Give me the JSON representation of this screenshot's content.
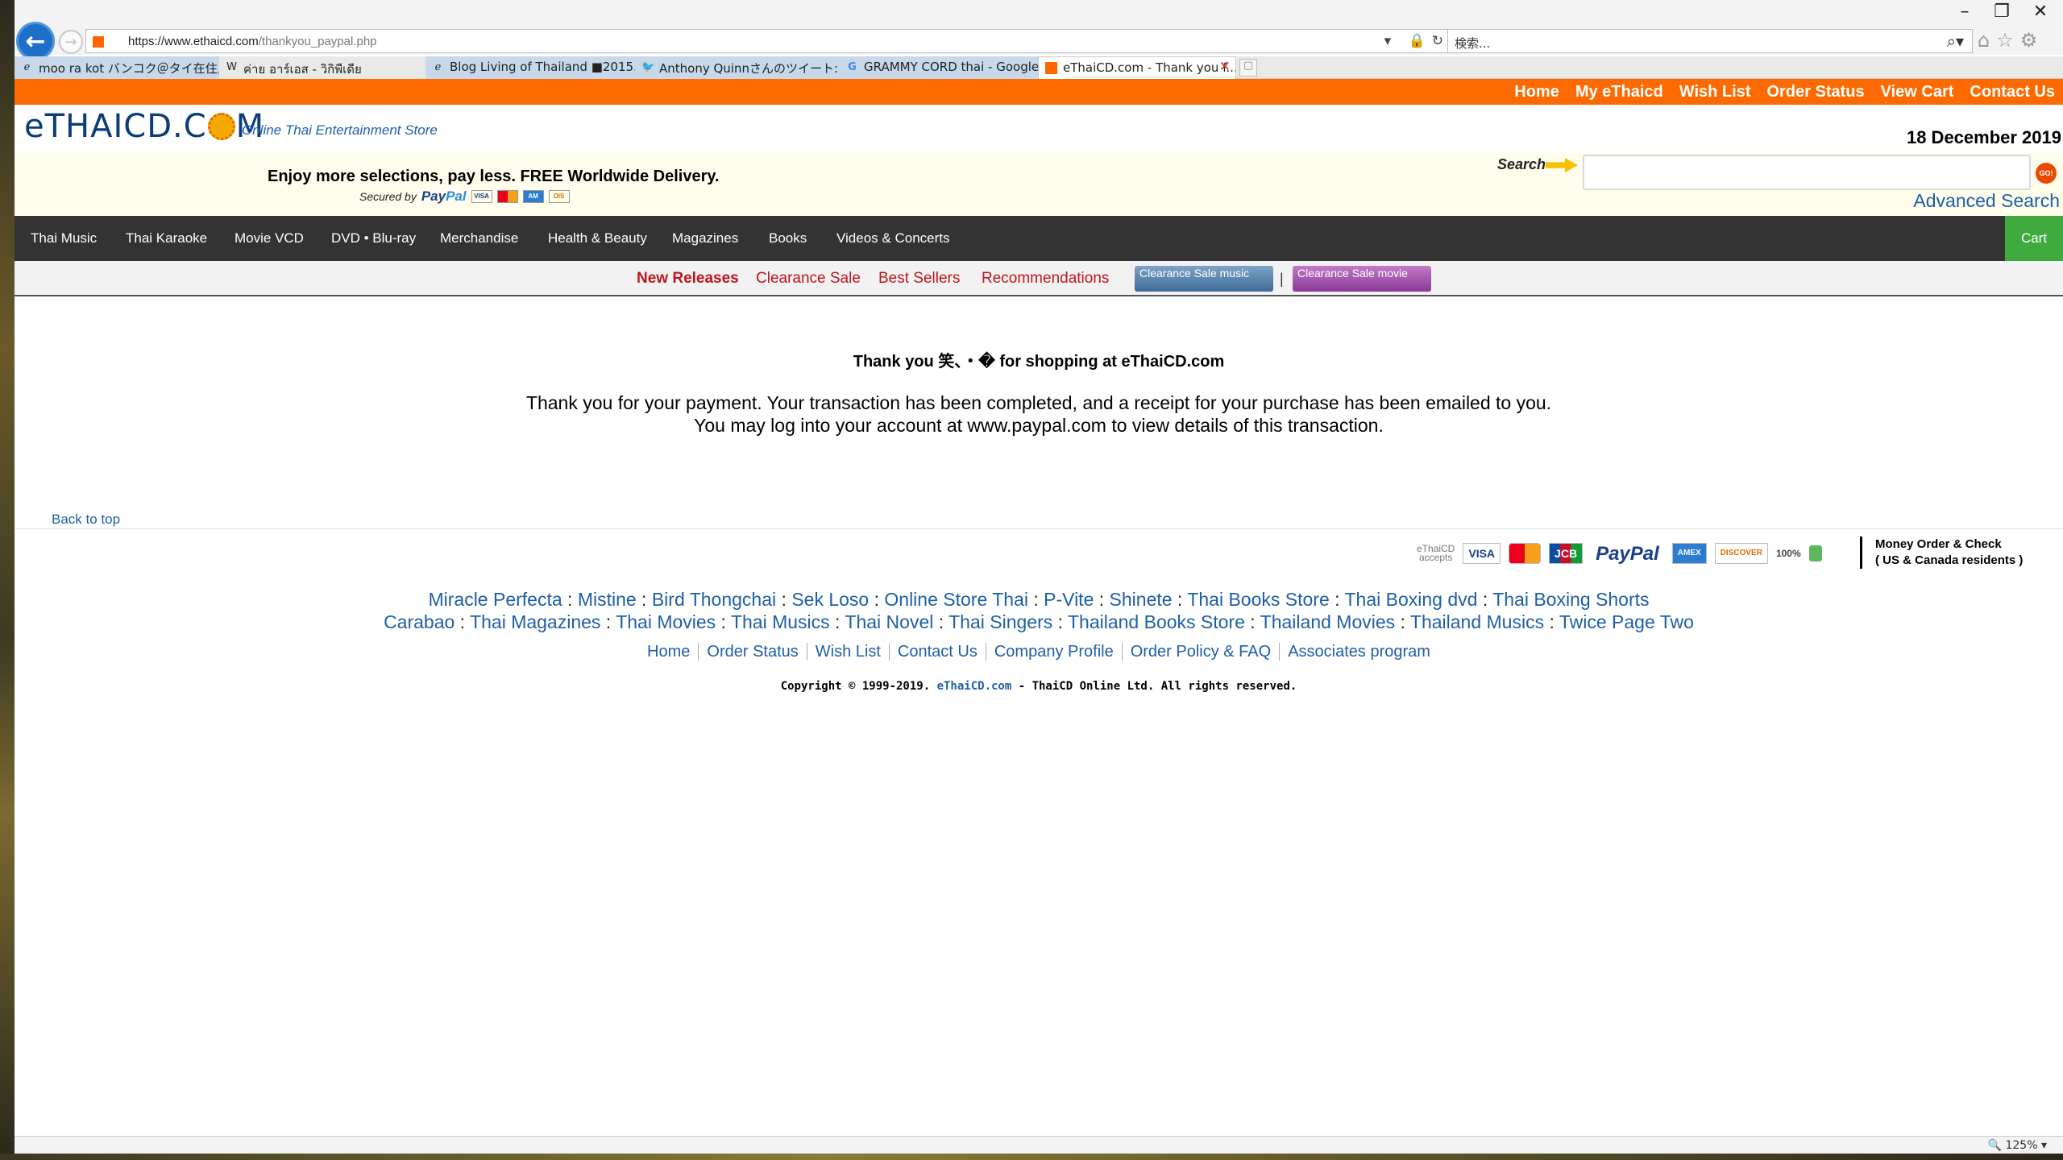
{
  "window_controls": {
    "minimize": "–",
    "restore": "❐",
    "close": "✕"
  },
  "browser": {
    "url_host": "https://www.ethaicd.com",
    "url_path": "/thankyou_paypal.php",
    "search_placeholder": "検索...",
    "zoom": "125%",
    "tabs": [
      {
        "title": "moo ra kot バンコク＠タイ在住／...",
        "icon": "ie-icon"
      },
      {
        "title": "ค่าย อาร์เอส - วิกิพีเดีย",
        "icon": "wikipedia-icon"
      },
      {
        "title": "Blog Living of Thailand ■2015...",
        "icon": "ie-icon"
      },
      {
        "title": "Anthony Quinnさんのツイート: \"レ...",
        "icon": "twitter-icon"
      },
      {
        "title": "GRAMMY CORD thai - Google ...",
        "icon": "google-icon"
      },
      {
        "title": "eThaiCD.com - Thank you f...",
        "icon": "ethaicd-icon",
        "active": true
      }
    ]
  },
  "topbar": {
    "links": [
      "Home",
      "My eThaicd",
      "Wish List",
      "Order Status",
      "View Cart",
      "Contact Us"
    ]
  },
  "header": {
    "logo_text_1": "eTHAICD.C",
    "logo_text_2": "M",
    "tagline": "Online Thai Entertainment Store",
    "date": "18 December 2019",
    "promo": "Enjoy more selections, pay less. FREE Worldwide Delivery.",
    "secured_by": "Secured by",
    "paypal_1": "Pay",
    "paypal_2": "Pal",
    "search_label": "Search",
    "go_label": "GO!",
    "advanced_search": "Advanced Search"
  },
  "categories": [
    "Thai Music",
    "Thai Karaoke",
    "Movie VCD",
    "DVD • Blu-ray",
    "Merchandise",
    "Health & Beauty",
    "Magazines",
    "Books",
    "Videos & Concerts"
  ],
  "cart_label": "Cart",
  "subnav": {
    "items": [
      "New Releases",
      "Clearance Sale",
      "Best Sellers",
      "Recommendations"
    ],
    "banner_music": "Clearance Sale music",
    "banner_movie": "Clearance Sale movie",
    "separator": "|"
  },
  "main": {
    "title": "Thank you 笑、・� for shopping at eThaiCD.com",
    "body_line1": "Thank you for your payment. Your transaction has been completed, and a receipt for your purchase has been emailed to you.",
    "body_line2": "You may log into your account at www.paypal.com to view details of this transaction.",
    "back_to_top": "Back to top"
  },
  "payments": {
    "accepts_1": "eThaiCD",
    "accepts_2": "accepts",
    "badges": [
      "VISA",
      "",
      "JCB",
      "PayPal",
      "AMEX",
      "DISCOVER"
    ],
    "security": "100%",
    "money_order_1": "Money Order & Check",
    "money_order_2": "( US & Canada residents )"
  },
  "footer": {
    "row1": [
      "Miracle Perfecta",
      "Mistine",
      "Bird Thongchai",
      "Sek Loso",
      "Online Store Thai",
      "P-Vite",
      "Shinete",
      "Thai Books Store",
      "Thai Boxing dvd",
      "Thai Boxing Shorts"
    ],
    "row2": [
      "Carabao",
      "Thai Magazines",
      "Thai Movies",
      "Thai Musics",
      "Thai Novel",
      "Thai Singers",
      "Thailand Books Store",
      "Thailand Movies",
      "Thailand Musics",
      "Twice Page Two"
    ],
    "nav": [
      "Home",
      "Order Status",
      "Wish List",
      "Contact Us",
      "Company Profile",
      "Order Policy & FAQ",
      "Associates program"
    ],
    "copyright_pre": "Copyright © 1999-2019.",
    "copyright_brand": "eThaiCD.com",
    "copyright_post": "- ThaiCD Online Ltd. All rights reserved."
  },
  "colors": {
    "accent_orange": "#ff6a00",
    "link_blue": "#1d5fa8",
    "nav_dark": "#333333",
    "cart_green": "#3faa3f",
    "subnav_red": "#c0151b"
  }
}
